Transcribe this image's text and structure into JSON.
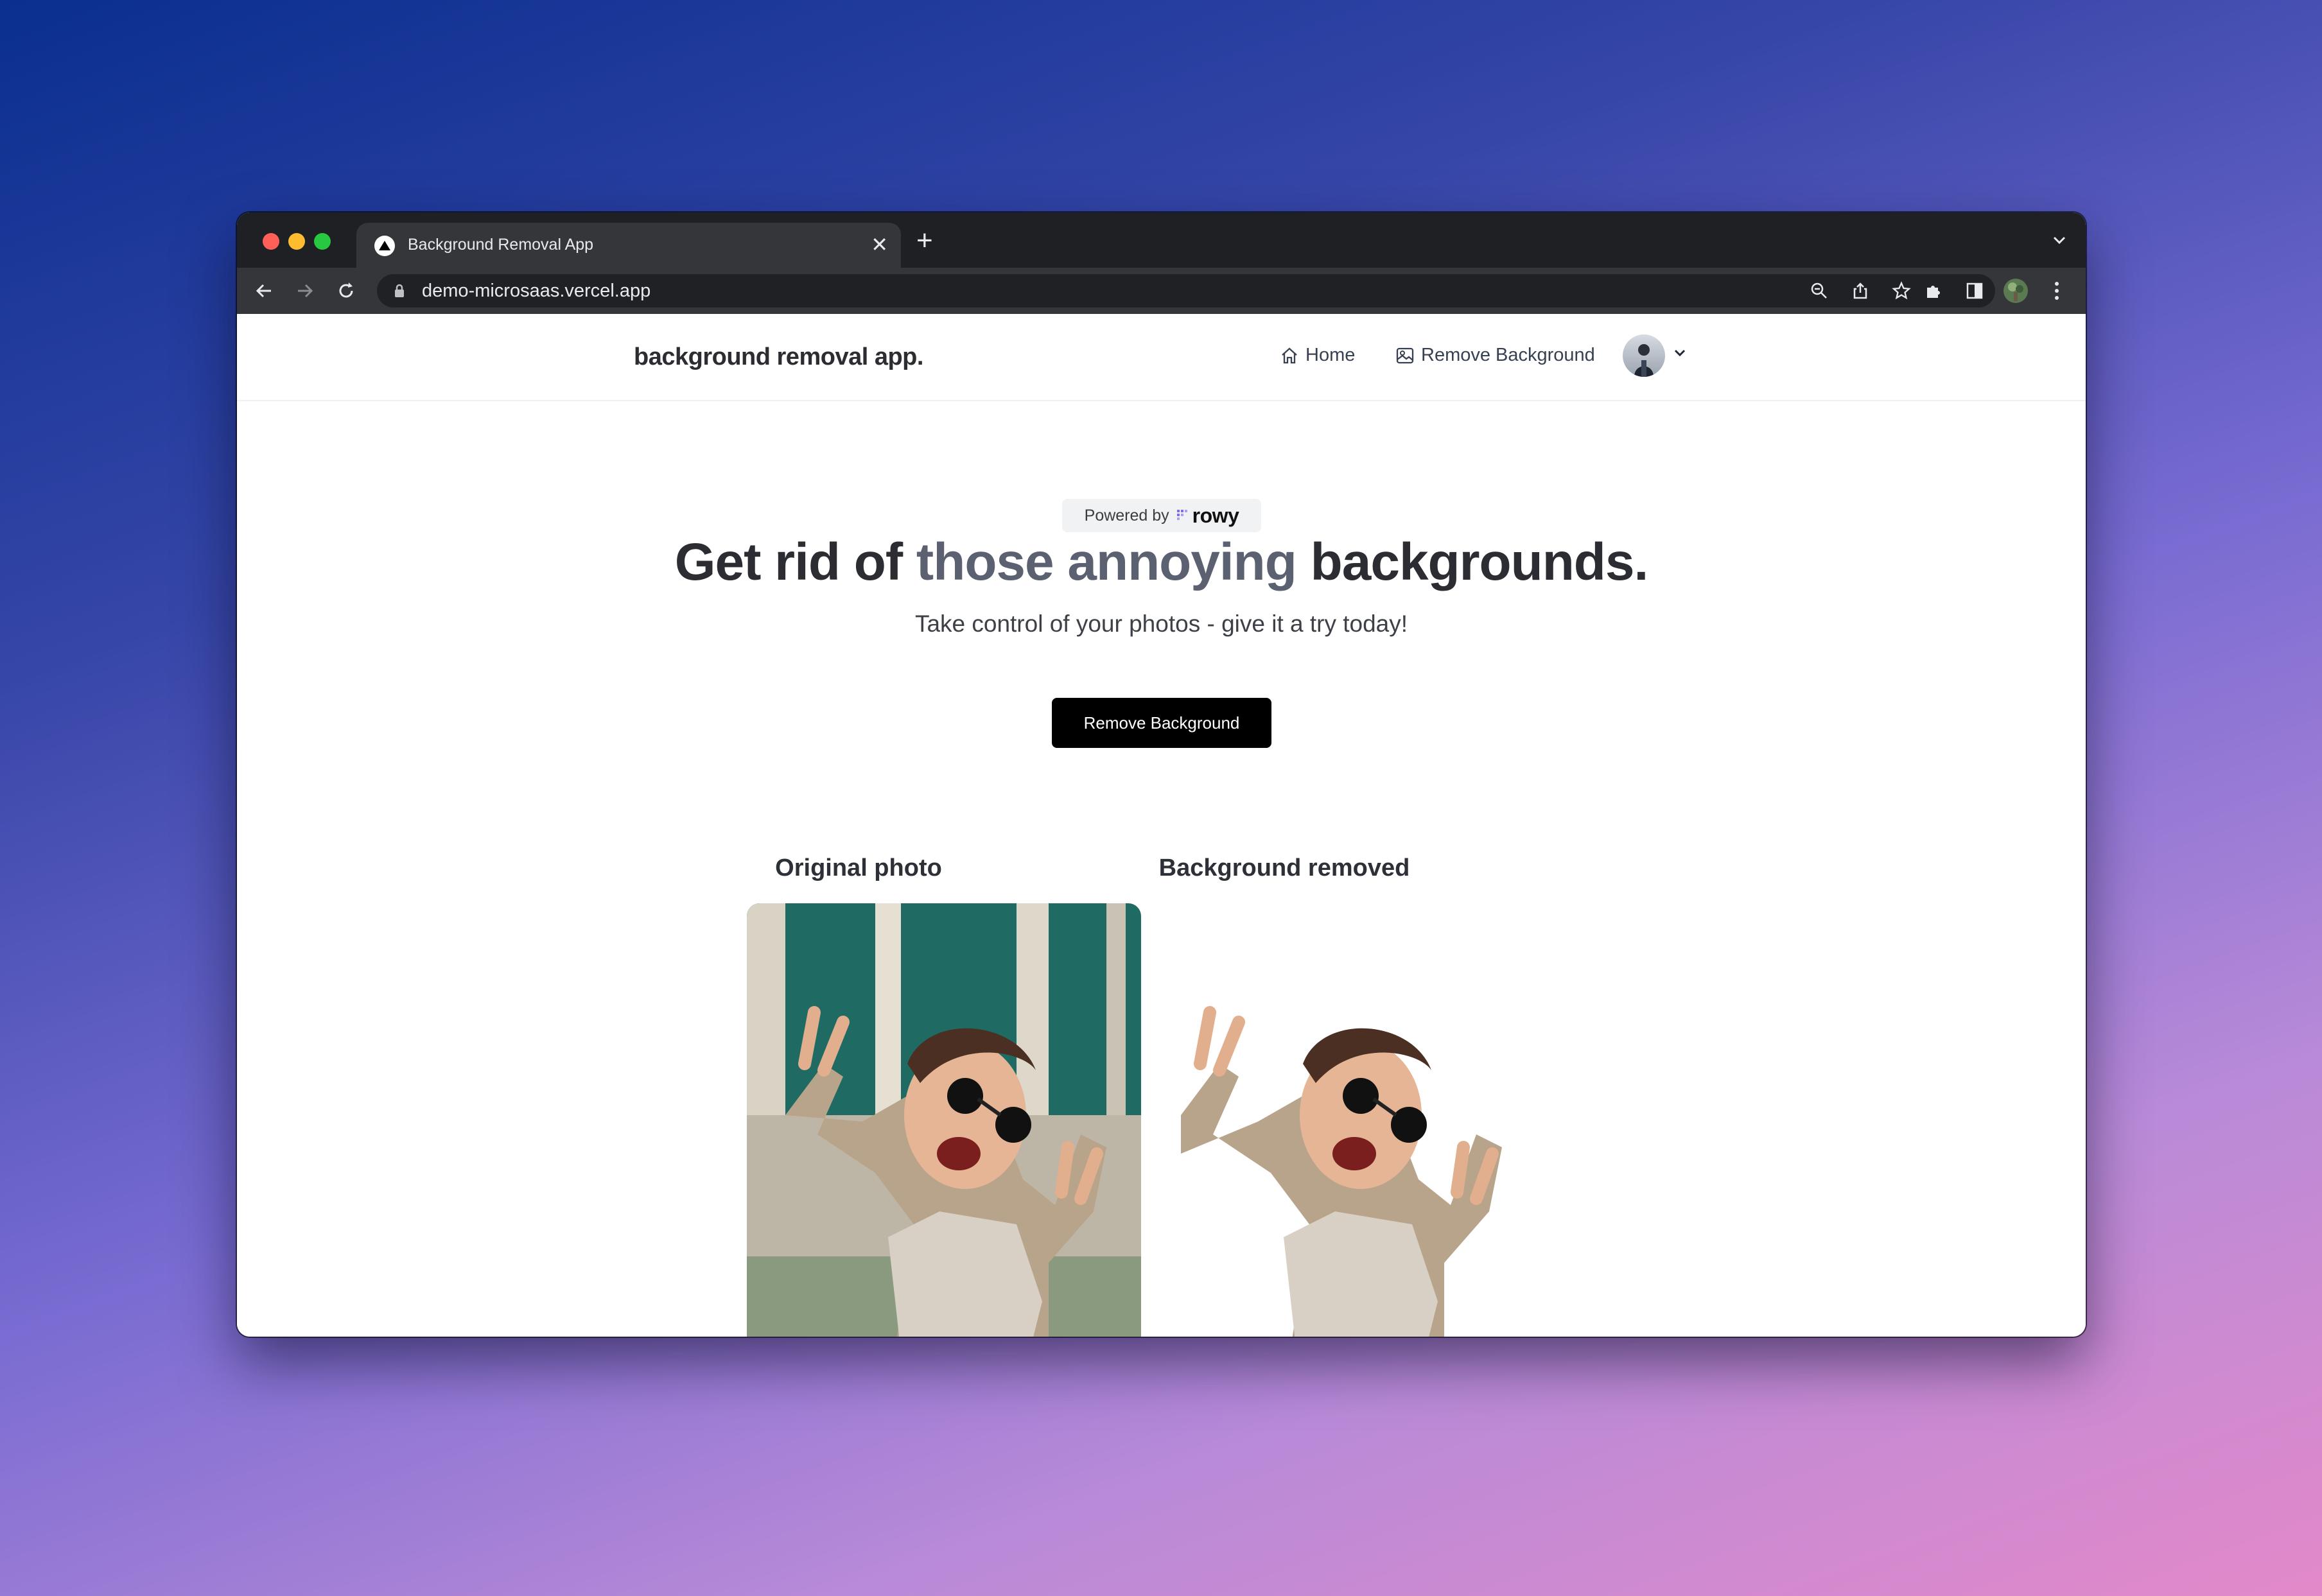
{
  "browser": {
    "tab_title": "Background Removal App",
    "url": "demo-microsaas.vercel.app"
  },
  "header": {
    "brand": "background removal app.",
    "nav": [
      {
        "label": "Home",
        "icon": "home-icon"
      },
      {
        "label": "Remove Background",
        "icon": "image-icon"
      }
    ]
  },
  "hero": {
    "powered_by": "Powered by",
    "powered_brand": "rowy",
    "headline_part1": "Get rid of",
    "headline_accent": "those annoying",
    "headline_part2": "backgrounds.",
    "subheadline": "Take control of your photos - give it a try today!",
    "cta_label": "Remove Background"
  },
  "comparison": {
    "original_label": "Original photo",
    "removed_label": "Background removed"
  },
  "colors": {
    "accent_text": "#5b6170",
    "cta_background": "#000000",
    "photo_background": "#1f6b63"
  }
}
